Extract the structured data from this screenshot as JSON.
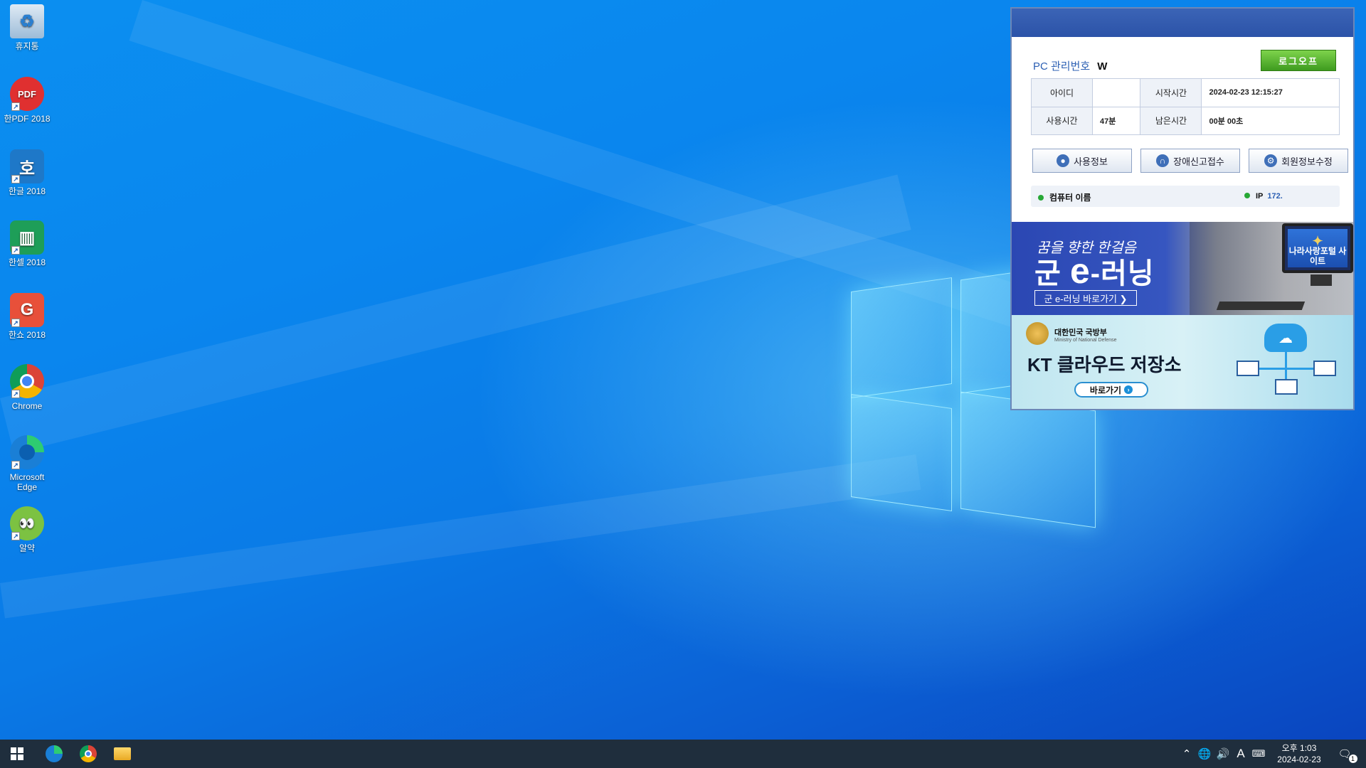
{
  "desktop": {
    "icons": [
      {
        "label": "휴지통",
        "icon": "recycle-bin-icon",
        "color": "#8fb8d8"
      },
      {
        "label": "한PDF 2018",
        "icon": "hanpdf-icon",
        "color": "#e03030"
      },
      {
        "label": "한글 2018",
        "icon": "hangul-icon",
        "color": "#1e78c8"
      },
      {
        "label": "한셀 2018",
        "icon": "hancell-icon",
        "color": "#1e9e58"
      },
      {
        "label": "한쇼 2018",
        "icon": "hanshow-icon",
        "color": "#e8503a"
      },
      {
        "label": "Chrome",
        "icon": "chrome-icon",
        "color": "#db4437"
      },
      {
        "label": "Microsoft Edge",
        "icon": "edge-icon",
        "color": "#1a7fd6"
      },
      {
        "label": "알약",
        "icon": "alyac-icon",
        "color": "#7cc242"
      }
    ]
  },
  "panel": {
    "pc_label": "PC 관리번호",
    "pc_value": "W",
    "logoff_label": "로그오프",
    "table": {
      "id_label": "아이디",
      "id_value": "",
      "start_label": "시작시간",
      "start_value": "2024-02-23 12:15:27",
      "used_label": "사용시간",
      "used_value": "47분",
      "remain_label": "남은시간",
      "remain_value": "00분 00초"
    },
    "buttons": {
      "usage_info": "사용정보",
      "report_issue": "장애신고접수",
      "edit_member": "회원정보수정"
    },
    "status": {
      "computer_name_label": "컴퓨터 이름",
      "ip_label": "IP",
      "ip_value": "172."
    }
  },
  "banner_elearning": {
    "tagline": "꿈을 향한 한걸음",
    "title_prefix": "군",
    "title_e": "e",
    "title_suffix": "-러닝",
    "link": "군 e-러닝 바로가기 ❯",
    "monitor_text": "나라사랑포털 사이트"
  },
  "banner_cloud": {
    "org_name": "대한민국 국방부",
    "org_name_en": "Ministry of National Defense",
    "title": "KT 클라우드 저장소",
    "button": "바로가기"
  },
  "taskbar": {
    "pinned": [
      "start-icon",
      "edge-icon",
      "chrome-icon",
      "file-explorer-icon"
    ],
    "tray": {
      "ime": "A",
      "clock_period_time": "오후 1:03",
      "clock_date": "2024-02-23",
      "notification_count": "1"
    }
  }
}
